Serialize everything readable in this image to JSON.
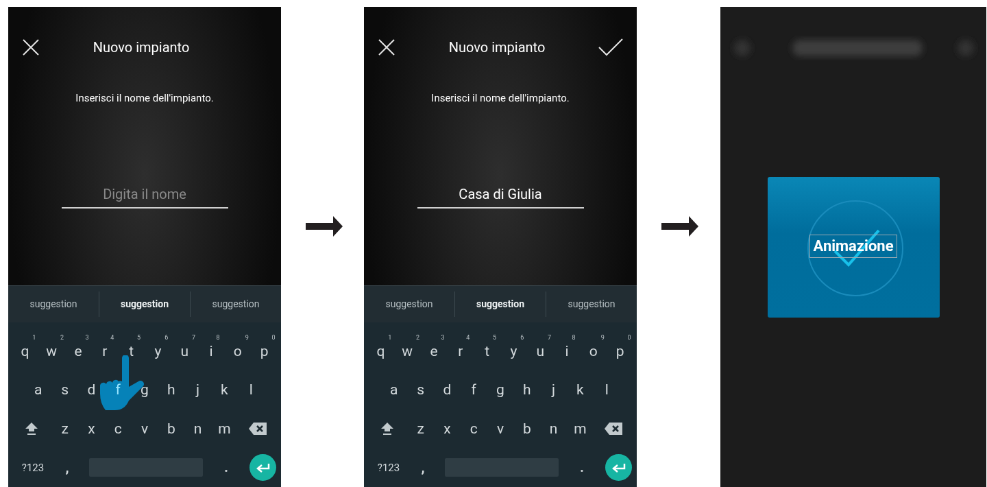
{
  "screens": [
    {
      "kind": "form",
      "title": "Nuovo impianto",
      "confirm_shown": false,
      "prompt": "Inserisci il nome dell'impianto.",
      "field": {
        "placeholder": "Digita il nome"
      },
      "suggestions": [
        {
          "label": "suggestion",
          "selected": false
        },
        {
          "label": "suggestion",
          "selected": true
        },
        {
          "label": "suggestion",
          "selected": false
        }
      ],
      "letter_rows": [
        [
          {
            "label": "q",
            "hint": "1",
            "pressed": false
          },
          {
            "label": "w",
            "hint": "2",
            "pressed": false
          },
          {
            "label": "e",
            "hint": "3",
            "pressed": false
          },
          {
            "label": "r",
            "hint": "4",
            "pressed": false
          },
          {
            "label": "t",
            "hint": "5",
            "pressed": false
          },
          {
            "label": "y",
            "hint": "6",
            "pressed": false
          },
          {
            "label": "u",
            "hint": "7",
            "pressed": false
          },
          {
            "label": "i",
            "hint": "8",
            "pressed": false
          },
          {
            "label": "o",
            "hint": "9",
            "pressed": false
          },
          {
            "label": "p",
            "hint": "0",
            "pressed": false
          }
        ],
        [
          {
            "label": "a",
            "pressed": false
          },
          {
            "label": "s",
            "pressed": false
          },
          {
            "label": "d",
            "pressed": false
          },
          {
            "label": "f",
            "pressed": true
          },
          {
            "label": "g",
            "pressed": false
          },
          {
            "label": "h",
            "pressed": false
          },
          {
            "label": "j",
            "pressed": false
          },
          {
            "label": "k",
            "pressed": false
          },
          {
            "label": "l",
            "pressed": false
          }
        ],
        [
          {
            "label": "z",
            "pressed": false
          },
          {
            "label": "x",
            "pressed": false
          },
          {
            "label": "c",
            "pressed": false
          },
          {
            "label": "v",
            "pressed": false
          },
          {
            "label": "b",
            "pressed": false
          },
          {
            "label": "n",
            "pressed": false
          },
          {
            "label": "m",
            "pressed": false
          }
        ]
      ],
      "bottom_row": {
        "symbols": "?123",
        "comma": ",",
        "period": "."
      }
    },
    {
      "kind": "form",
      "title": "Nuovo impianto",
      "confirm_shown": true,
      "prompt": "Inserisci il nome dell'impianto.",
      "field": {
        "value": "Casa di Giulia"
      },
      "suggestions": [
        {
          "label": "suggestion",
          "selected": false
        },
        {
          "label": "suggestion",
          "selected": true
        },
        {
          "label": "suggestion",
          "selected": false
        }
      ],
      "letter_rows": [
        [
          {
            "label": "q",
            "hint": "1",
            "pressed": false
          },
          {
            "label": "w",
            "hint": "2",
            "pressed": false
          },
          {
            "label": "e",
            "hint": "3",
            "pressed": false
          },
          {
            "label": "r",
            "hint": "4",
            "pressed": false
          },
          {
            "label": "t",
            "hint": "5",
            "pressed": false
          },
          {
            "label": "y",
            "hint": "6",
            "pressed": false
          },
          {
            "label": "u",
            "hint": "7",
            "pressed": false
          },
          {
            "label": "i",
            "hint": "8",
            "pressed": false
          },
          {
            "label": "o",
            "hint": "9",
            "pressed": false
          },
          {
            "label": "p",
            "hint": "0",
            "pressed": false
          }
        ],
        [
          {
            "label": "a",
            "pressed": false
          },
          {
            "label": "s",
            "pressed": false
          },
          {
            "label": "d",
            "pressed": false
          },
          {
            "label": "f",
            "pressed": false
          },
          {
            "label": "g",
            "pressed": false
          },
          {
            "label": "h",
            "pressed": false
          },
          {
            "label": "j",
            "pressed": false
          },
          {
            "label": "k",
            "pressed": false
          },
          {
            "label": "l",
            "pressed": false
          }
        ],
        [
          {
            "label": "z",
            "pressed": false
          },
          {
            "label": "x",
            "pressed": false
          },
          {
            "label": "c",
            "pressed": false
          },
          {
            "label": "v",
            "pressed": false
          },
          {
            "label": "b",
            "pressed": false
          },
          {
            "label": "n",
            "pressed": false
          },
          {
            "label": "m",
            "pressed": false
          }
        ]
      ],
      "bottom_row": {
        "symbols": "?123",
        "comma": ",",
        "period": "."
      }
    },
    {
      "kind": "animation",
      "label": "Animazione"
    }
  ]
}
